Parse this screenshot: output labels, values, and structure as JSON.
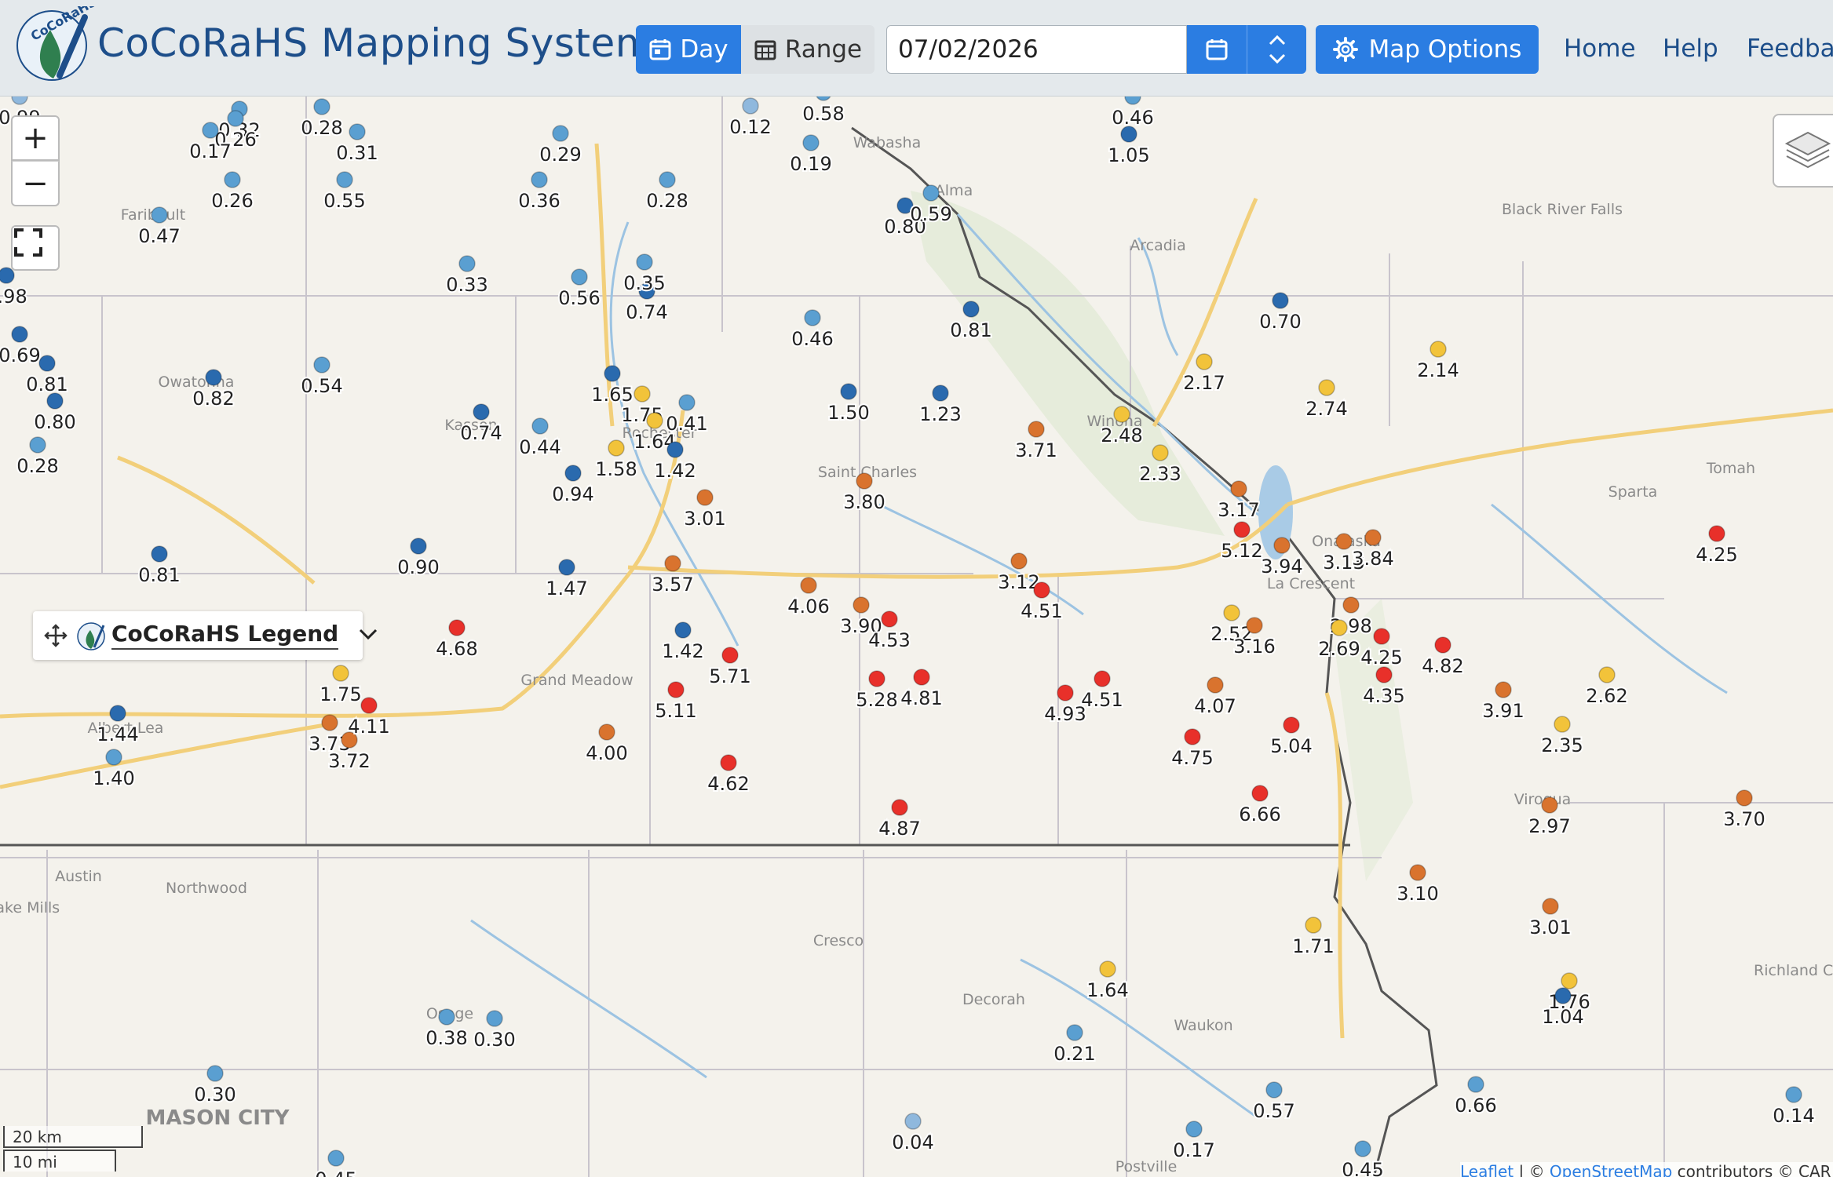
{
  "header": {
    "app_title": "CoCoRaHS Mapping System",
    "logo_text": "CoCoRaHS",
    "day_label": "Day",
    "range_label": "Range",
    "date_value": "07/02/2026",
    "map_options_label": "Map Options",
    "nav": [
      "Home",
      "Help",
      "Feedbac"
    ]
  },
  "map_controls": {
    "zoom_in": "+",
    "zoom_out": "−"
  },
  "legend": {
    "title": "CoCoRaHS Legend"
  },
  "scale": {
    "km": "20 km",
    "mi": "10 mi"
  },
  "attribution": {
    "leaflet": "Leaflet",
    "separator": " | © ",
    "osm": "OpenStreetMap",
    "rest": " contributors © CAR"
  },
  "colors": {
    "header_bg": "#e4e9ec",
    "brand_blue": "#1d4e8a",
    "button_blue": "#2b7de2",
    "pale_blue": "#8fb8dd",
    "light_blue": "#5a9fd1",
    "dark_blue": "#2a6aae",
    "yellow": "#f2c33a",
    "orange": "#d9732e",
    "red": "#e8302a",
    "road": "#f2cf7a",
    "river": "#9cc3e2"
  },
  "places": [
    {
      "name": "Faribault"
    },
    {
      "name": "Owatonna"
    },
    {
      "name": "Albert Lea"
    },
    {
      "name": "Austin"
    },
    {
      "name": "Grand Meadow"
    },
    {
      "name": "Saint Charles"
    },
    {
      "name": "Wabasha"
    },
    {
      "name": "Alma"
    },
    {
      "name": "Arcadia"
    },
    {
      "name": "Black River Falls"
    },
    {
      "name": "Winona"
    },
    {
      "name": "Onalaska"
    },
    {
      "name": "La Crescent"
    },
    {
      "name": "Sparta"
    },
    {
      "name": "Tomah"
    },
    {
      "name": "Viroqua"
    },
    {
      "name": "Cresco"
    },
    {
      "name": "Decorah"
    },
    {
      "name": "Waukon"
    },
    {
      "name": "Northwood"
    },
    {
      "name": "Osage"
    },
    {
      "name": "MASON CITY"
    },
    {
      "name": "Postville"
    },
    {
      "name": "Lake Mills"
    },
    {
      "name": "Richland Center"
    },
    {
      "name": "Kasson"
    },
    {
      "name": "Rochester"
    }
  ],
  "stations": [
    {
      "v": "0.99",
      "c": "pale"
    },
    {
      "v": "0.32",
      "c": "light"
    },
    {
      "v": "0.26",
      "c": "light"
    },
    {
      "v": "0.17",
      "c": "light"
    },
    {
      "v": "0.28",
      "c": "light"
    },
    {
      "v": "0.31",
      "c": "light"
    },
    {
      "v": "0.26",
      "c": "light"
    },
    {
      "v": "0.55",
      "c": "light"
    },
    {
      "v": "0.47",
      "c": "light"
    },
    {
      "v": "0.98",
      "c": "dark"
    },
    {
      "v": "0.33",
      "c": "light"
    },
    {
      "v": "0.29",
      "c": "light"
    },
    {
      "v": "0.28",
      "c": "light"
    },
    {
      "v": "0.36",
      "c": "light"
    },
    {
      "v": "0.74",
      "c": "dark"
    },
    {
      "v": "0.56",
      "c": "light"
    },
    {
      "v": "0.35",
      "c": "light"
    },
    {
      "v": "0.12",
      "c": "pale"
    },
    {
      "v": "0.58",
      "c": "light"
    },
    {
      "v": "0.19",
      "c": "light"
    },
    {
      "v": "0.80",
      "c": "dark"
    },
    {
      "v": "0.59",
      "c": "light"
    },
    {
      "v": "0.46",
      "c": "light"
    },
    {
      "v": "1.05",
      "c": "dark"
    },
    {
      "v": "0.81",
      "c": "dark"
    },
    {
      "v": "0.70",
      "c": "dark"
    },
    {
      "v": "0.69",
      "c": "dark"
    },
    {
      "v": "0.81",
      "c": "dark"
    },
    {
      "v": "0.80",
      "c": "dark"
    },
    {
      "v": "0.28",
      "c": "light"
    },
    {
      "v": "0.82",
      "c": "dark"
    },
    {
      "v": "0.54",
      "c": "light"
    },
    {
      "v": "0.74",
      "c": "dark"
    },
    {
      "v": "0.44",
      "c": "light"
    },
    {
      "v": "0.41",
      "c": "light"
    },
    {
      "v": "1.75",
      "c": "yellow"
    },
    {
      "v": "1.65",
      "c": "dark"
    },
    {
      "v": "1.64",
      "c": "yellow"
    },
    {
      "v": "1.58",
      "c": "yellow"
    },
    {
      "v": "1.42",
      "c": "dark"
    },
    {
      "v": "0.94",
      "c": "dark"
    },
    {
      "v": "0.46",
      "c": "light"
    },
    {
      "v": "1.50",
      "c": "dark"
    },
    {
      "v": "1.23",
      "c": "dark"
    },
    {
      "v": "3.71",
      "c": "orange"
    },
    {
      "v": "2.48",
      "c": "yellow"
    },
    {
      "v": "2.33",
      "c": "yellow"
    },
    {
      "v": "2.17",
      "c": "yellow"
    },
    {
      "v": "2.74",
      "c": "yellow"
    },
    {
      "v": "2.14",
      "c": "yellow"
    },
    {
      "v": "3.01",
      "c": "orange"
    },
    {
      "v": "3.80",
      "c": "orange"
    },
    {
      "v": "0.81",
      "c": "dark"
    },
    {
      "v": "0.90",
      "c": "dark"
    },
    {
      "v": "1.47",
      "c": "dark"
    },
    {
      "v": "3.57",
      "c": "orange"
    },
    {
      "v": "4.06",
      "c": "orange"
    },
    {
      "v": "3.90",
      "c": "orange"
    },
    {
      "v": "4.53",
      "c": "red"
    },
    {
      "v": "3.12",
      "c": "orange"
    },
    {
      "v": "4.51",
      "c": "red"
    },
    {
      "v": "3.17",
      "c": "orange"
    },
    {
      "v": "5.12",
      "c": "red"
    },
    {
      "v": "3.94",
      "c": "orange"
    },
    {
      "v": "3.13",
      "c": "orange"
    },
    {
      "v": "3.84",
      "c": "orange"
    },
    {
      "v": "4.25",
      "c": "red"
    },
    {
      "v": "1.42",
      "c": "dark"
    },
    {
      "v": "4.68",
      "c": "red"
    },
    {
      "v": "5.71",
      "c": "red"
    },
    {
      "v": "5.11",
      "c": "red"
    },
    {
      "v": "5.28",
      "c": "red"
    },
    {
      "v": "4.81",
      "c": "red"
    },
    {
      "v": "4.93",
      "c": "red"
    },
    {
      "v": "4.51",
      "c": "red"
    },
    {
      "v": "2.52",
      "c": "yellow"
    },
    {
      "v": "3.16",
      "c": "orange"
    },
    {
      "v": "2.98",
      "c": "orange"
    },
    {
      "v": "2.69",
      "c": "yellow"
    },
    {
      "v": "4.25",
      "c": "red"
    },
    {
      "v": "4.82",
      "c": "red"
    },
    {
      "v": "4.35",
      "c": "red"
    },
    {
      "v": "3.91",
      "c": "orange"
    },
    {
      "v": "2.62",
      "c": "yellow"
    },
    {
      "v": "4.07",
      "c": "orange"
    },
    {
      "v": "4.75",
      "c": "red"
    },
    {
      "v": "5.04",
      "c": "red"
    },
    {
      "v": "2.35",
      "c": "yellow"
    },
    {
      "v": "1.75",
      "c": "yellow"
    },
    {
      "v": "1.44",
      "c": "dark"
    },
    {
      "v": "1.40",
      "c": "light"
    },
    {
      "v": "3.73",
      "c": "orange"
    },
    {
      "v": "3.72",
      "c": "orange"
    },
    {
      "v": "4.11",
      "c": "red"
    },
    {
      "v": "4.00",
      "c": "orange"
    },
    {
      "v": "4.62",
      "c": "red"
    },
    {
      "v": "6.66",
      "c": "red"
    },
    {
      "v": "4.87",
      "c": "red"
    },
    {
      "v": "2.97",
      "c": "orange"
    },
    {
      "v": "3.70",
      "c": "orange"
    },
    {
      "v": "3.10",
      "c": "orange"
    },
    {
      "v": "3.01",
      "c": "orange"
    },
    {
      "v": "1.71",
      "c": "yellow"
    },
    {
      "v": "1.64",
      "c": "yellow"
    },
    {
      "v": "1.76",
      "c": "yellow"
    },
    {
      "v": "1.04",
      "c": "dark"
    },
    {
      "v": "0.21",
      "c": "light"
    },
    {
      "v": "0.38",
      "c": "light"
    },
    {
      "v": "0.30",
      "c": "light"
    },
    {
      "v": "0.30",
      "c": "light"
    },
    {
      "v": "0.57",
      "c": "light"
    },
    {
      "v": "0.66",
      "c": "light"
    },
    {
      "v": "0.14",
      "c": "light"
    },
    {
      "v": "0.04",
      "c": "pale"
    },
    {
      "v": "0.17",
      "c": "light"
    },
    {
      "v": "0.45",
      "c": "light"
    },
    {
      "v": "0.45",
      "c": "light"
    }
  ]
}
